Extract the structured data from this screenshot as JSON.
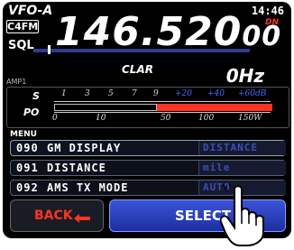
{
  "header": {
    "vfo": "VFO-A",
    "time": "14:46",
    "mode": "C4FM",
    "sql": "SQL"
  },
  "frequency": {
    "main": "146.520",
    "tail": "00",
    "tag": "DN"
  },
  "clar": {
    "label": "CLAR",
    "value": "0Hz"
  },
  "amp_label": "AMP1",
  "meter": {
    "s_label": "S",
    "po_label": "PO",
    "s_ticks": [
      "1",
      "3",
      "5",
      "7",
      "9",
      "+20",
      "+40",
      "+60dB"
    ],
    "po_ticks": [
      "0",
      "10",
      "50",
      "100",
      "150W"
    ]
  },
  "menu": {
    "header": "MENU",
    "rows": [
      {
        "num": "090",
        "name": "GM DISPLAY",
        "value": "DISTANCE"
      },
      {
        "num": "091",
        "name": "DISTANCE",
        "value": "mile"
      },
      {
        "num": "092",
        "name": "AMS TX MODE",
        "value": "AUTO"
      }
    ]
  },
  "buttons": {
    "back": "BACK",
    "select": "SELECT"
  },
  "colors": {
    "accent_blue": "#2f47cf",
    "red": "#ff3322",
    "value_blue": "#3c4eb6"
  }
}
